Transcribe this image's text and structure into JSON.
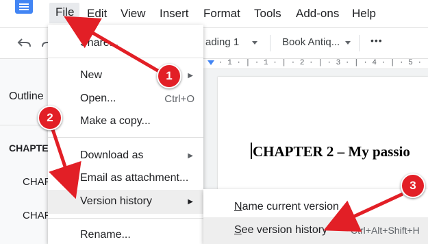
{
  "menubar": {
    "items": [
      "File",
      "Edit",
      "View",
      "Insert",
      "Format",
      "Tools",
      "Add-ons",
      "Help"
    ]
  },
  "toolbar": {
    "style_label": "ading 1",
    "font_label": "Book Antiq...",
    "more_label": "•••"
  },
  "ruler": {
    "marks": "· 1 · | · 1 · | · 2 · | · 3 · | · 4 · | · 5 ·"
  },
  "outline": {
    "title": "Outline",
    "items": [
      "CHAPTE",
      "CHAP",
      "CHAP"
    ]
  },
  "document": {
    "heading": "CHAPTER 2 – My passio"
  },
  "file_menu": {
    "share": "Share...",
    "new": "New",
    "open": "Open...",
    "open_shortcut": "Ctrl+O",
    "make_copy": "Make a copy...",
    "download_as": "Download as",
    "email_attachment": "Email as attachment...",
    "version_history": "Version history",
    "rename": "Rename..."
  },
  "version_submenu": {
    "name_current_first": "N",
    "name_current_rest": "ame current version",
    "see_history_first": "S",
    "see_history_rest": "ee version history",
    "see_history_shortcut": "Ctrl+Alt+Shift+H"
  },
  "callouts": [
    "1",
    "2",
    "3"
  ],
  "colors": {
    "callout_red": "#e21f26",
    "arrow_red": "#e21f26",
    "docs_blue": "#4285f4",
    "menu_highlight": "#eeeeee"
  },
  "icons": [
    "docs-logo-icon",
    "undo-icon",
    "redo-icon",
    "submenu-arrow-icon",
    "dropdown-caret-icon"
  ]
}
